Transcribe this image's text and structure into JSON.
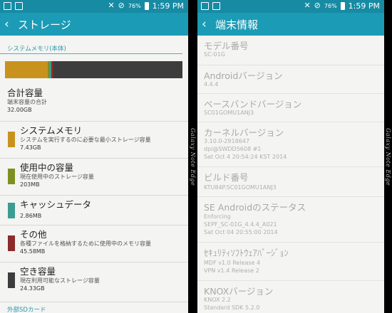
{
  "status_bar": {
    "battery_pct": "76%",
    "time": "1:59 PM"
  },
  "left_screen": {
    "title": "ストレージ",
    "section_system": "システムメモリ(本体)",
    "usage_bar": [
      {
        "color": "#c8931d",
        "fraction": 0.24
      },
      {
        "color": "#7f8f1f",
        "fraction": 0.012
      },
      {
        "color": "#3c9c93",
        "fraction": 0.01
      },
      {
        "color": "#8d2a2a",
        "fraction": 0.012
      },
      {
        "color": "#3d3d3d",
        "fraction": 0.726
      }
    ],
    "total": {
      "title": "合計容量",
      "sub": "端末容量の合計",
      "value": "32.00GB"
    },
    "items": [
      {
        "title": "システムメモリ",
        "sub": "システムを実行するのに必要な最小ストレージ容量",
        "value": "7.43GB",
        "color": "#c8931d"
      },
      {
        "title": "使用中の容量",
        "sub": "現在使用中のストレージ容量",
        "value": "203MB",
        "color": "#7f8f1f"
      },
      {
        "title": "キャッシュデータ",
        "sub": "",
        "value": "2.86MB",
        "color": "#3c9c93"
      },
      {
        "title": "その他",
        "sub": "各種ファイルを格納するために使用中のメモリ容量",
        "value": "45.58MB",
        "color": "#8d2a2a"
      },
      {
        "title": "空き容量",
        "sub": "現在利用可能なストレージ容量",
        "value": "24.33GB",
        "color": "#3d3d3d"
      }
    ],
    "section_sd": "外部SDカード"
  },
  "right_screen": {
    "title": "端末情報",
    "rows": [
      {
        "key": "モデル番号",
        "lines": [
          "SC-01G"
        ]
      },
      {
        "key": "Androidバージョン",
        "lines": [
          "4.4.4"
        ]
      },
      {
        "key": "ベースバンドバージョン",
        "lines": [
          "SC01GOMU1ANJ3"
        ]
      },
      {
        "key": "カーネルバージョン",
        "lines": [
          "3.10.0-2918647",
          "dpi@SWDD5608 #1",
          "Sat Oct 4 20:54:24 KST 2014"
        ]
      },
      {
        "key": "ビルド番号",
        "lines": [
          "KTU84P.SC01GOMU1ANJ3"
        ]
      },
      {
        "key": "SE Androidのステータス",
        "lines": [
          "Enforcing",
          "SEPF_SC-01G_4.4.4_A021",
          "Sat Oct 04 20:55:00 2014"
        ]
      },
      {
        "key": "ｾｷｭﾘﾃｨｿﾌﾄｳｪｱﾊﾞｰｼﾞｮﾝ",
        "lines": [
          "MDF v1.0 Release 4",
          "VPN v1.4 Release 2"
        ]
      },
      {
        "key": "KNOXバージョン",
        "lines": [
          "KNOX 2.2",
          "Standard SDK 5.2.0"
        ]
      }
    ]
  },
  "watermark": "Galaxy Note Edge"
}
